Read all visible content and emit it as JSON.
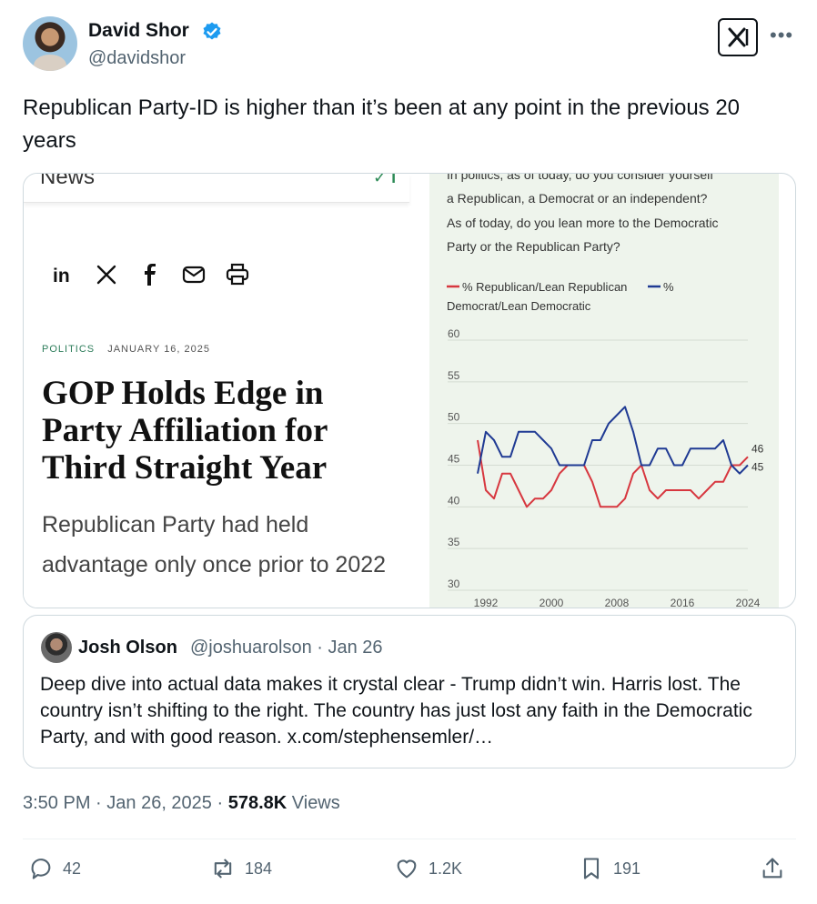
{
  "author": {
    "name": "David Shor",
    "handle": "@davidshor"
  },
  "tweet": {
    "text": "Republican Party-ID is higher than it’s been at any point in the previous 20 years"
  },
  "media": {
    "article": {
      "top_label": "News",
      "category": "POLITICS",
      "date": "JANUARY 16, 2025",
      "headline": "GOP Holds Edge in Party Affiliation for Third Straight Year",
      "subheadline": "Republican Party had held advantage only once prior to 2022"
    },
    "chart_question_lines": [
      "In politics, as of today, do you consider yourself",
      "a Republican, a Democrat or an independent?",
      "As of today, do you lean more to the Democratic",
      "Party or the Republican Party?"
    ]
  },
  "chart_data": {
    "type": "line",
    "legend": [
      "% Republican/Lean Republican",
      "% Democrat/Lean Democratic"
    ],
    "legend_placement": "top",
    "x": [
      1991,
      1992,
      1993,
      1994,
      1995,
      1996,
      1997,
      1998,
      1999,
      2000,
      2001,
      2002,
      2003,
      2004,
      2005,
      2006,
      2007,
      2008,
      2009,
      2010,
      2011,
      2012,
      2013,
      2014,
      2015,
      2016,
      2017,
      2018,
      2019,
      2020,
      2021,
      2022,
      2023,
      2024
    ],
    "x_ticks": [
      "1992",
      "2000",
      "2008",
      "2016",
      "2024"
    ],
    "y_ticks": [
      "30",
      "35",
      "40",
      "45",
      "50",
      "55",
      "60"
    ],
    "ylim": [
      30,
      60
    ],
    "grid": true,
    "series": [
      {
        "name": "% Republican/Lean Republican",
        "color": "#d7373f",
        "values": [
          48,
          42,
          41,
          44,
          44,
          42,
          40,
          41,
          41,
          42,
          44,
          45,
          45,
          45,
          43,
          40,
          40,
          40,
          41,
          44,
          45,
          42,
          41,
          42,
          42,
          42,
          42,
          41,
          42,
          43,
          43,
          45,
          45,
          46
        ],
        "end_label": "46"
      },
      {
        "name": "% Democrat/Lean Democratic",
        "color": "#1f3a93",
        "values": [
          44,
          49,
          48,
          46,
          46,
          49,
          49,
          49,
          48,
          47,
          45,
          45,
          45,
          45,
          48,
          48,
          50,
          51,
          52,
          49,
          45,
          45,
          47,
          47,
          45,
          45,
          47,
          47,
          47,
          47,
          48,
          45,
          44,
          45
        ],
        "end_label": "45"
      }
    ]
  },
  "quoted_tweet": {
    "name": "Josh Olson",
    "handle": "@joshuarolson",
    "date": "Jan 26",
    "text": "Deep dive into actual data makes it crystal clear - Trump didn’t win. Harris lost. The country isn’t shifting to the right. The country has just lost any faith in the Democratic Party, and with good reason. x.com/stephensemler/…"
  },
  "meta": {
    "time": "3:50 PM",
    "date": "Jan 26, 2025",
    "views_count": "578.8K",
    "views_label": "Views"
  },
  "actions": {
    "replies": "42",
    "reposts": "184",
    "likes": "1.2K",
    "bookmarks": "191"
  },
  "colors": {
    "text_primary": "#0f1419",
    "text_secondary": "#536471",
    "verified_blue": "#1d9bf0",
    "chart_background": "#eef4ec"
  }
}
